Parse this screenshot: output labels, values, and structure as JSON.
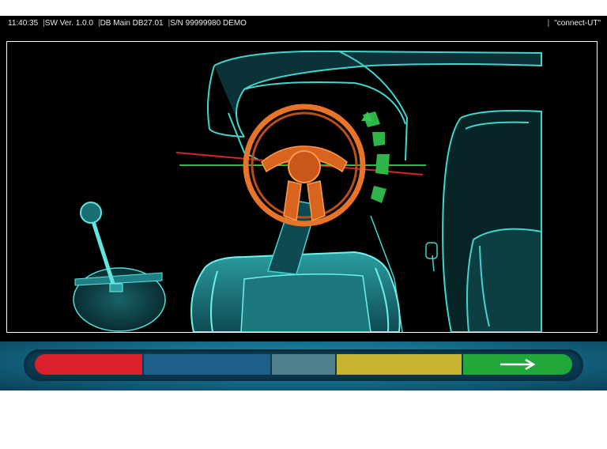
{
  "status_bar": {
    "time": "11:40:35",
    "sw_version": "SW Ver. 1.0.0",
    "db_version": "DB Main DB27.01",
    "serial": "S/N 99999980 DEMO",
    "connection": "\"connect-UT\""
  },
  "scene": {
    "description_icon": "steering-wheel-alignment-scene",
    "steering_wheel_color": "#e8742a",
    "interior_color": "#3fd6d0",
    "reference_line_color": "#d8242c",
    "alignment_line_color": "#2fb54a",
    "rotation_indicator_color": "#2fb54a"
  },
  "progress_bar": {
    "segments": [
      {
        "name": "red",
        "color": "#d9202c"
      },
      {
        "name": "blue",
        "color": "#1d5f8a"
      },
      {
        "name": "gray",
        "color": "#4f7f8a"
      },
      {
        "name": "yellow",
        "color": "#c8b330"
      },
      {
        "name": "green",
        "color": "#22a83a",
        "icon": "arrow-right-icon"
      }
    ]
  }
}
